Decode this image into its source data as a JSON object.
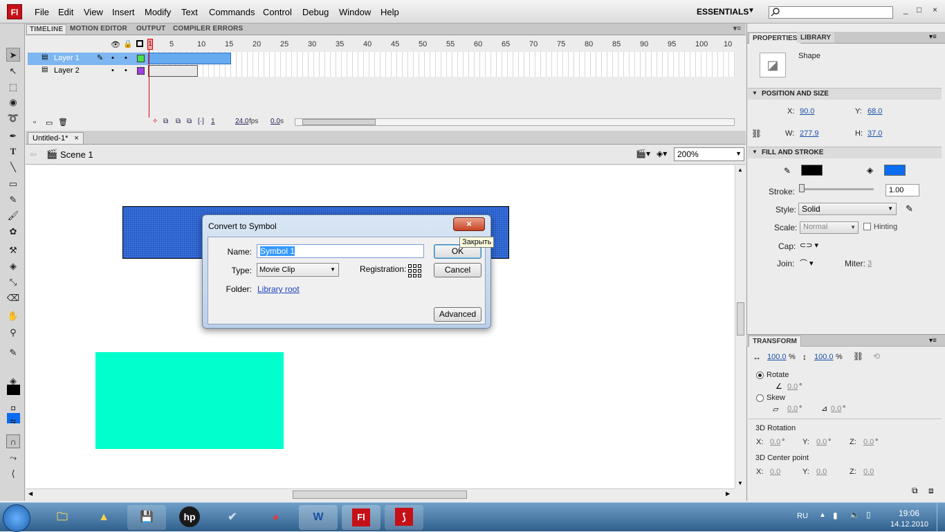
{
  "app": {
    "logo": "Fl",
    "menu": [
      "File",
      "Edit",
      "View",
      "Insert",
      "Modify",
      "Text",
      "Commands",
      "Control",
      "Debug",
      "Window",
      "Help"
    ],
    "workspace": "ESSENTIALS",
    "window_controls": [
      "_",
      "□",
      "×"
    ]
  },
  "timeline": {
    "tabs": [
      "TIMELINE",
      "MOTION EDITOR",
      "OUTPUT",
      "COMPILER ERRORS"
    ],
    "frame_numbers": [
      "1",
      "5",
      "10",
      "15",
      "20",
      "25",
      "30",
      "35",
      "40",
      "45",
      "50",
      "55",
      "60",
      "65",
      "70",
      "75",
      "80",
      "85",
      "90",
      "95",
      "100",
      "10"
    ],
    "layers": [
      {
        "name": "Layer 1",
        "color": "#4be04b",
        "selected": true
      },
      {
        "name": "Layer 2",
        "color": "#a040e0",
        "selected": false
      }
    ],
    "status": {
      "frame": "1",
      "fps": "24.0",
      "fps_unit": "fps",
      "time": "0.0",
      "time_unit": "s"
    }
  },
  "document": {
    "tab": "Untitled-1*",
    "tab_close": "×",
    "scene": "Scene 1",
    "zoom": "200%"
  },
  "dialog": {
    "title": "Convert to Symbol",
    "close": "×",
    "name_label": "Name:",
    "name_value": "Symbol 1",
    "type_label": "Type:",
    "type_value": "Movie Clip",
    "registration_label": "Registration:",
    "folder_label": "Folder:",
    "folder_value": "Library root",
    "ok": "OK",
    "cancel": "Cancel",
    "advanced": "Advanced",
    "tooltip": "Закрыть"
  },
  "properties": {
    "tabs": [
      "PROPERTIES",
      "LIBRARY"
    ],
    "object_type": "Shape",
    "position_size": {
      "header": "POSITION AND SIZE",
      "x_label": "X:",
      "x": "90.0",
      "y_label": "Y:",
      "y": "68.0",
      "w_label": "W:",
      "w": "277.9",
      "h_label": "H:",
      "h": "37.0"
    },
    "fill_stroke": {
      "header": "FILL AND STROKE",
      "stroke_color": "#000000",
      "fill_color": "#0a6cf0",
      "stroke_label": "Stroke:",
      "stroke_value": "1.00",
      "style_label": "Style:",
      "style_value": "Solid",
      "scale_label": "Scale:",
      "scale_value": "Normal",
      "hinting_label": "Hinting",
      "cap_label": "Cap:",
      "join_label": "Join:",
      "miter_label": "Miter:",
      "miter_value": "3"
    },
    "transform": {
      "header": "TRANSFORM",
      "scale_w": "100.0",
      "scale_h": "100.0",
      "pct": "%",
      "rotate_label": "Rotate",
      "rotate_value": "0.0",
      "skew_label": "Skew",
      "skew_h": "0.0",
      "skew_v": "0.0",
      "deg": "°",
      "rot3d_label": "3D Rotation",
      "rot3d": {
        "x": "0.0",
        "y": "0.0",
        "z": "0.0"
      },
      "center3d_label": "3D Center point",
      "center3d": {
        "x": "0.0",
        "y": "0.0",
        "z": "0.0"
      },
      "x_label": "X:",
      "y_label": "Y:",
      "z_label": "Z:"
    }
  },
  "stage": {
    "blue_rect_color": "#3a73e0",
    "cyan_rect_color": "#00ffcc"
  },
  "taskbar": {
    "lang": "RU",
    "time": "19:06",
    "date": "14.12.2010",
    "apps": [
      "folder-icon",
      "triangle-app-icon",
      "save-icon",
      "hp-icon",
      "check-app-icon",
      "chrome-icon",
      "word-icon",
      "flash-icon",
      "acrobat-icon"
    ],
    "flash_label": "Fl"
  }
}
